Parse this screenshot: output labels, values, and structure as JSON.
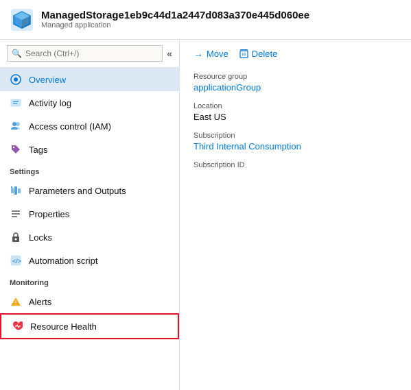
{
  "header": {
    "title": "ManagedStorage1eb9c44d1a2447d083a370e445d060ee",
    "subtitle": "Managed application"
  },
  "search": {
    "placeholder": "Search (Ctrl+/)"
  },
  "nav": {
    "items": [
      {
        "id": "overview",
        "label": "Overview",
        "active": true
      },
      {
        "id": "activity-log",
        "label": "Activity log",
        "active": false
      },
      {
        "id": "access-control",
        "label": "Access control (IAM)",
        "active": false
      },
      {
        "id": "tags",
        "label": "Tags",
        "active": false
      }
    ],
    "sections": [
      {
        "label": "Settings",
        "items": [
          {
            "id": "parameters",
            "label": "Parameters and Outputs"
          },
          {
            "id": "properties",
            "label": "Properties"
          },
          {
            "id": "locks",
            "label": "Locks"
          },
          {
            "id": "automation",
            "label": "Automation script"
          }
        ]
      },
      {
        "label": "Monitoring",
        "items": [
          {
            "id": "alerts",
            "label": "Alerts"
          },
          {
            "id": "resource-health",
            "label": "Resource Health",
            "highlight": true
          }
        ]
      }
    ]
  },
  "toolbar": {
    "move_label": "Move",
    "delete_label": "Delete"
  },
  "info": {
    "resource_group_label": "Resource group",
    "resource_group_value": "applicationGroup",
    "location_label": "Location",
    "location_value": "East US",
    "subscription_label": "Subscription",
    "subscription_value": "Third Internal Consumption",
    "subscription_id_label": "Subscription ID",
    "subscription_id_value": ""
  }
}
